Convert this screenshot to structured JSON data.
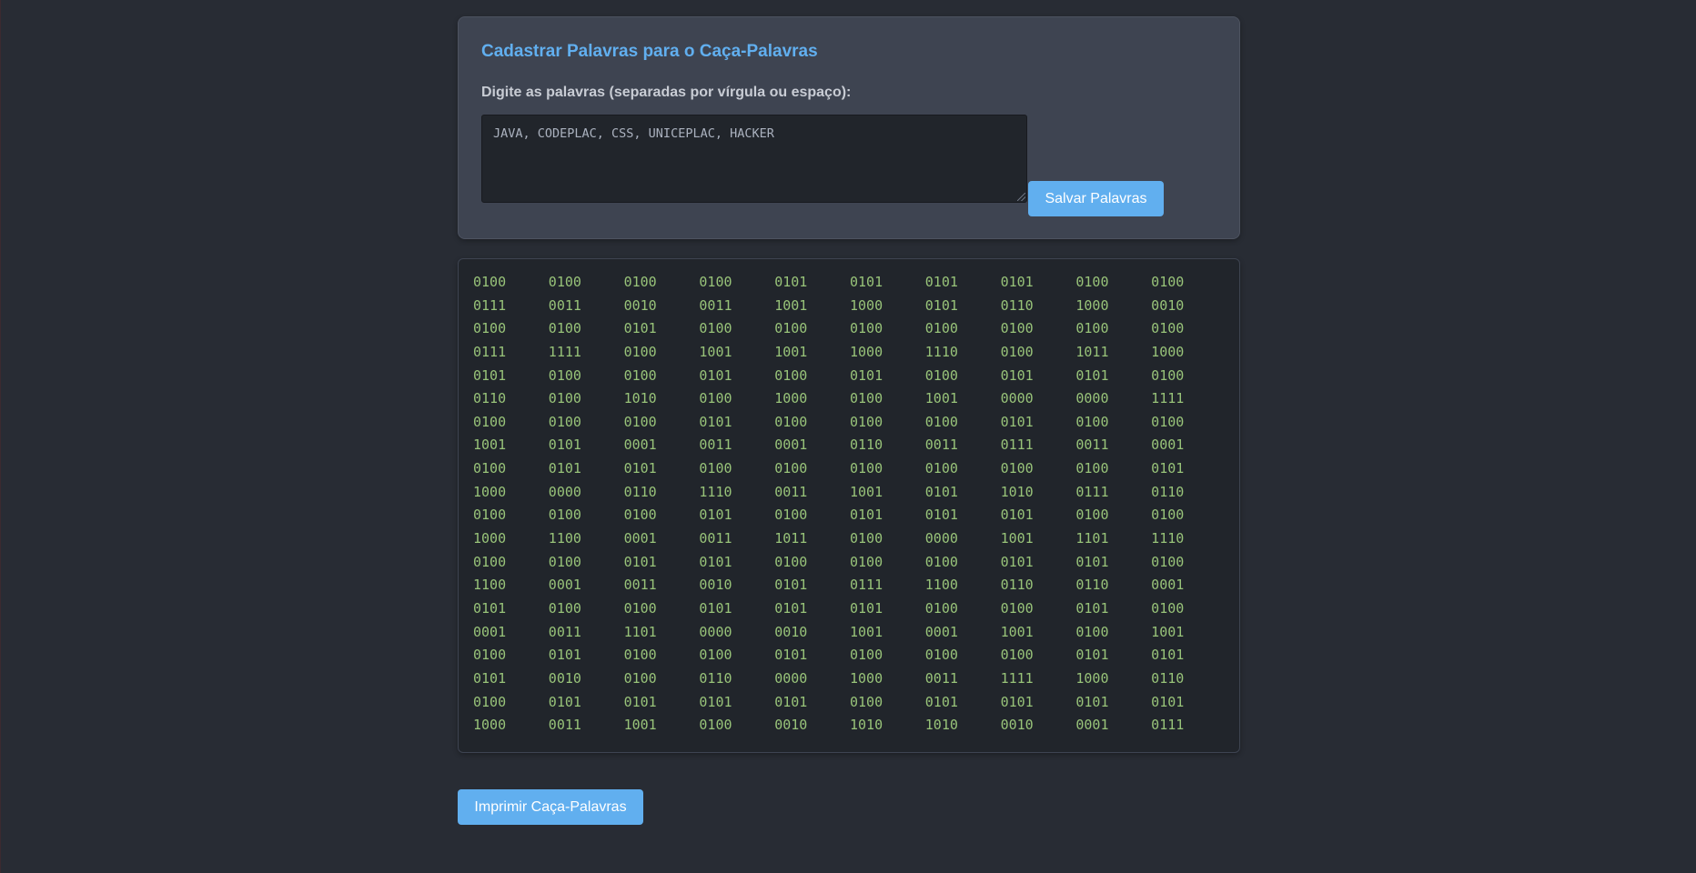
{
  "form": {
    "title": "Cadastrar Palavras para o Caça-Palavras",
    "input_label": "Digite as palavras (separadas por vírgula ou espaço):",
    "input_value": "JAVA, CODEPLAC, CSS, UNICEPLAC, HACKER",
    "save_label": "Salvar Palavras"
  },
  "grid": {
    "rows": [
      [
        "0100",
        "0100",
        "0100",
        "0100",
        "0101",
        "0101",
        "0101",
        "0101",
        "0100",
        "0100"
      ],
      [
        "0111",
        "0011",
        "0010",
        "0011",
        "1001",
        "1000",
        "0101",
        "0110",
        "1000",
        "0010"
      ],
      [
        "0100",
        "0100",
        "0101",
        "0100",
        "0100",
        "0100",
        "0100",
        "0100",
        "0100",
        "0100"
      ],
      [
        "0111",
        "1111",
        "0100",
        "1001",
        "1001",
        "1000",
        "1110",
        "0100",
        "1011",
        "1000"
      ],
      [
        "0101",
        "0100",
        "0100",
        "0101",
        "0100",
        "0101",
        "0100",
        "0101",
        "0101",
        "0100"
      ],
      [
        "0110",
        "0100",
        "1010",
        "0100",
        "1000",
        "0100",
        "1001",
        "0000",
        "0000",
        "1111"
      ],
      [
        "0100",
        "0100",
        "0100",
        "0101",
        "0100",
        "0100",
        "0100",
        "0101",
        "0100",
        "0100"
      ],
      [
        "1001",
        "0101",
        "0001",
        "0011",
        "0001",
        "0110",
        "0011",
        "0111",
        "0011",
        "0001"
      ],
      [
        "0100",
        "0101",
        "0101",
        "0100",
        "0100",
        "0100",
        "0100",
        "0100",
        "0100",
        "0101"
      ],
      [
        "1000",
        "0000",
        "0110",
        "1110",
        "0011",
        "1001",
        "0101",
        "1010",
        "0111",
        "0110"
      ],
      [
        "0100",
        "0100",
        "0100",
        "0101",
        "0100",
        "0101",
        "0101",
        "0101",
        "0100",
        "0100"
      ],
      [
        "1000",
        "1100",
        "0001",
        "0011",
        "1011",
        "0100",
        "0000",
        "1001",
        "1101",
        "1110"
      ],
      [
        "0100",
        "0100",
        "0101",
        "0101",
        "0100",
        "0100",
        "0100",
        "0101",
        "0101",
        "0100"
      ],
      [
        "1100",
        "0001",
        "0011",
        "0010",
        "0101",
        "0111",
        "1100",
        "0110",
        "0110",
        "0001"
      ],
      [
        "0101",
        "0100",
        "0100",
        "0101",
        "0101",
        "0101",
        "0100",
        "0100",
        "0101",
        "0100"
      ],
      [
        "0001",
        "0011",
        "1101",
        "0000",
        "0010",
        "1001",
        "0001",
        "1001",
        "0100",
        "1001"
      ],
      [
        "0100",
        "0101",
        "0100",
        "0100",
        "0101",
        "0100",
        "0100",
        "0100",
        "0101",
        "0101"
      ],
      [
        "0101",
        "0010",
        "0100",
        "0110",
        "0000",
        "1000",
        "0011",
        "1111",
        "1000",
        "0110"
      ],
      [
        "0100",
        "0101",
        "0101",
        "0101",
        "0101",
        "0100",
        "0101",
        "0101",
        "0101",
        "0101"
      ],
      [
        "1000",
        "0011",
        "1001",
        "0100",
        "0010",
        "1010",
        "1010",
        "0010",
        "0001",
        "0111"
      ]
    ]
  },
  "actions": {
    "print_label": "Imprimir Caça-Palavras"
  },
  "colors": {
    "background": "#282c34",
    "card": "#3e4451",
    "accent": "#61afef",
    "grid_text": "#98c379"
  }
}
